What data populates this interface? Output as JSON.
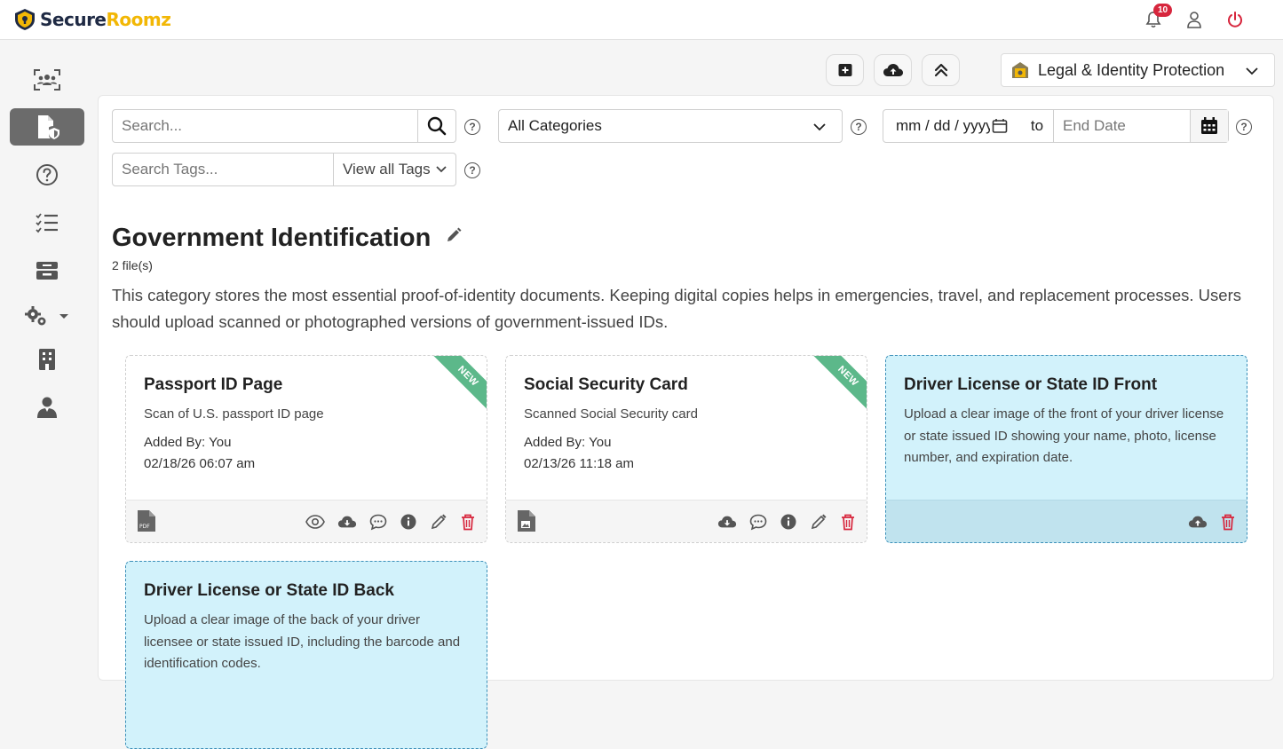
{
  "app": {
    "name_part1": "Secure",
    "name_part2": "Roomz",
    "notification_count": "10"
  },
  "toolbar": {
    "room_name": "Legal & Identity Protection"
  },
  "filters": {
    "search_placeholder": "Search...",
    "category": "All Categories",
    "start_date_placeholder": "mm / dd / yyyy",
    "to_label": "to",
    "end_date_placeholder": "End Date",
    "tags_placeholder": "Search Tags...",
    "view_tags_label": "View all Tags"
  },
  "category": {
    "title": "Government Identification",
    "file_count": "2 file(s)",
    "description": "This category stores the most essential proof-of-identity documents. Keeping digital copies helps in emergencies, travel, and replacement processes. Users should upload scanned or photographed versions of government-issued IDs."
  },
  "cards": [
    {
      "title": "Passport ID Page",
      "subtitle": "Scan of U.S. passport ID page",
      "added_by": "Added By: You",
      "date": "02/18/26 06:07 am",
      "ribbon": "NEW",
      "file_type": "pdf"
    },
    {
      "title": "Social Security Card",
      "subtitle": "Scanned Social Security card",
      "added_by": "Added By: You",
      "date": "02/13/26 11:18 am",
      "ribbon": "NEW",
      "file_type": "image"
    },
    {
      "title": "Driver License or State ID Front",
      "subtitle": "Upload a clear image of the front of your driver license or state issued ID showing your name, photo, license number, and expiration date."
    },
    {
      "title": "Driver License or State ID Back",
      "subtitle": "Upload a clear image of the back of your driver licensee or state issued ID, including the barcode and identification codes."
    }
  ],
  "colors": {
    "accent_yellow": "#f2b705",
    "navy": "#1f2a44",
    "delete_red": "#d7263d",
    "new_ribbon": "#5cb88a",
    "required_card_bg": "#d2f2fb"
  }
}
